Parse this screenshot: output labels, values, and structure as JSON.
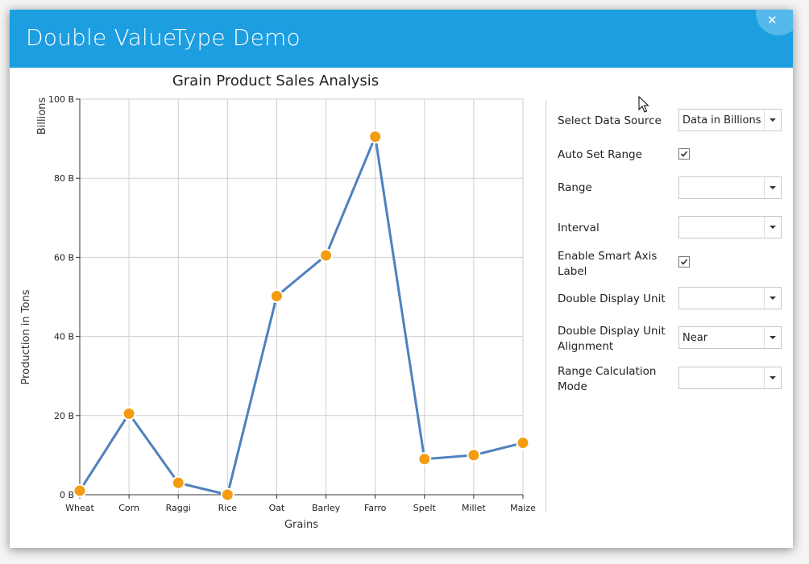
{
  "window": {
    "title": "Double ValueType Demo",
    "close_icon": "close-icon"
  },
  "chart_data": {
    "type": "line",
    "title": "Grain Product Sales Analysis",
    "xlabel": "Grains",
    "ylabel": "Production in Tons",
    "unit_label": "Billions",
    "categories": [
      "Wheat",
      "Corn",
      "Raggi",
      "Rice",
      "Oat",
      "Barley",
      "Farro",
      "Spelt",
      "Millet",
      "Maize"
    ],
    "series": [
      {
        "values": [
          1,
          20.5,
          3,
          0,
          50.2,
          60.5,
          90.5,
          9,
          10,
          13.1
        ],
        "color": "#4f81bd",
        "marker_color": "#f39c12"
      }
    ],
    "ylim": [
      0,
      100
    ],
    "y_ticks": [
      0,
      20,
      40,
      60,
      80,
      100
    ],
    "y_tick_labels": [
      "0 B",
      "20 B",
      "40 B",
      "60 B",
      "80 B",
      "100 B"
    ],
    "grid": true
  },
  "settings": {
    "data_source_label": "Select Data Source",
    "data_source_value": "Data in Billions",
    "auto_range_label": "Auto Set Range",
    "auto_range_checked": true,
    "range_label": "Range",
    "range_value": "",
    "interval_label": "Interval",
    "interval_value": "",
    "smart_axis_label": "Enable Smart Axis Label",
    "smart_axis_checked": true,
    "display_unit_label": "Double Display Unit",
    "display_unit_value": "",
    "unit_alignment_label": "Double Display Unit Alignment",
    "unit_alignment_value": "Near",
    "range_calc_label": "Range Calculation Mode",
    "range_calc_value": ""
  },
  "colors": {
    "title_bar": "#1d9ee0",
    "line": "#4f81bd",
    "marker": "#f39c12"
  }
}
